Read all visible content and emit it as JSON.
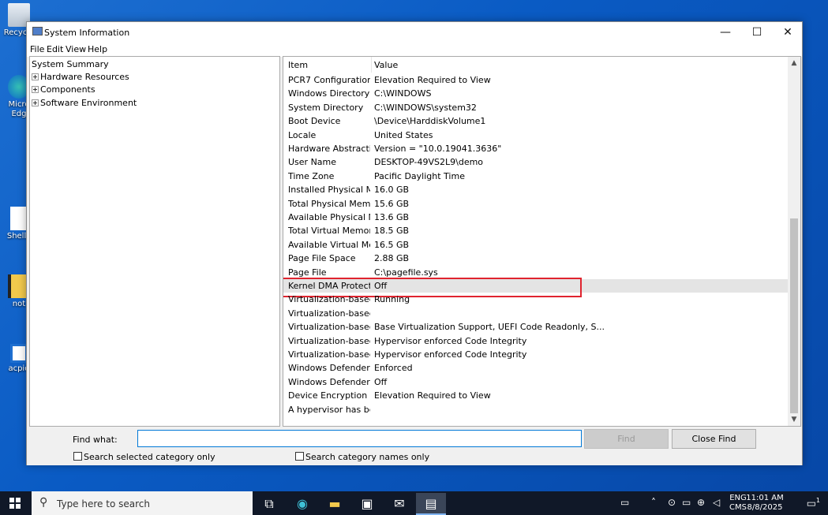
{
  "desktop": {
    "icons": [
      {
        "label": "Recycle",
        "icon": "recycle-bin-icon"
      },
      {
        "label": "Micro Edg",
        "icon": "edge-icon"
      },
      {
        "label": "Shellx",
        "icon": "file-icon"
      },
      {
        "label": "not",
        "icon": "folder-icon"
      },
      {
        "label": "acpid",
        "icon": "file-icon"
      }
    ]
  },
  "window": {
    "title": "System Information",
    "minimize": "—",
    "maximize": "☐",
    "close": "✕",
    "menu": [
      "File",
      "Edit",
      "View",
      "Help"
    ]
  },
  "tree": {
    "root": "System Summary",
    "children": [
      "Hardware Resources",
      "Components",
      "Software Environment"
    ]
  },
  "list": {
    "columns": [
      "Item",
      "Value"
    ],
    "rows": [
      {
        "item": "PCR7 Configuration",
        "value": "Elevation Required to View"
      },
      {
        "item": "Windows Directory",
        "value": "C:\\WINDOWS"
      },
      {
        "item": "System Directory",
        "value": "C:\\WINDOWS\\system32"
      },
      {
        "item": "Boot Device",
        "value": "\\Device\\HarddiskVolume1"
      },
      {
        "item": "Locale",
        "value": "United States"
      },
      {
        "item": "Hardware Abstractio...",
        "value": "Version = \"10.0.19041.3636\""
      },
      {
        "item": "User Name",
        "value": "DESKTOP-49VS2L9\\demo"
      },
      {
        "item": "Time Zone",
        "value": "Pacific Daylight Time"
      },
      {
        "item": "Installed Physical Me...",
        "value": "16.0 GB"
      },
      {
        "item": "Total Physical Memo...",
        "value": "15.6 GB"
      },
      {
        "item": "Available Physical M...",
        "value": "13.6 GB"
      },
      {
        "item": "Total Virtual Memory",
        "value": "18.5 GB"
      },
      {
        "item": "Available Virtual Me...",
        "value": "16.5 GB"
      },
      {
        "item": "Page File Space",
        "value": "2.88 GB"
      },
      {
        "item": "Page File",
        "value": "C:\\pagefile.sys"
      },
      {
        "item": "Kernel DMA Protecti...",
        "value": "Off"
      },
      {
        "item": "Virtualization-based...",
        "value": "Running"
      },
      {
        "item": "Virtualization-based...",
        "value": ""
      },
      {
        "item": "Virtualization-based...",
        "value": "Base Virtualization Support, UEFI Code Readonly, S..."
      },
      {
        "item": "Virtualization-based...",
        "value": "Hypervisor enforced Code Integrity"
      },
      {
        "item": "Virtualization-based...",
        "value": "Hypervisor enforced Code Integrity"
      },
      {
        "item": "Windows Defender ...",
        "value": "Enforced"
      },
      {
        "item": "Windows Defender ...",
        "value": "Off"
      },
      {
        "item": "Device Encryption S...",
        "value": "Elevation Required to View"
      },
      {
        "item": "A hypervisor has be...",
        "value": ""
      }
    ],
    "highlight_color": "#e0242f"
  },
  "findbar": {
    "label": "Find what:",
    "value": "",
    "find_button": "Find",
    "close_button": "Close Find",
    "check_selected": "Search selected category only",
    "check_names": "Search category names only"
  },
  "taskbar": {
    "search_placeholder": "Type here to search",
    "lang_top": "ENG",
    "lang_bottom": "CMS",
    "time": "11:01 AM",
    "date": "8/8/2025",
    "notification_count": "1"
  }
}
